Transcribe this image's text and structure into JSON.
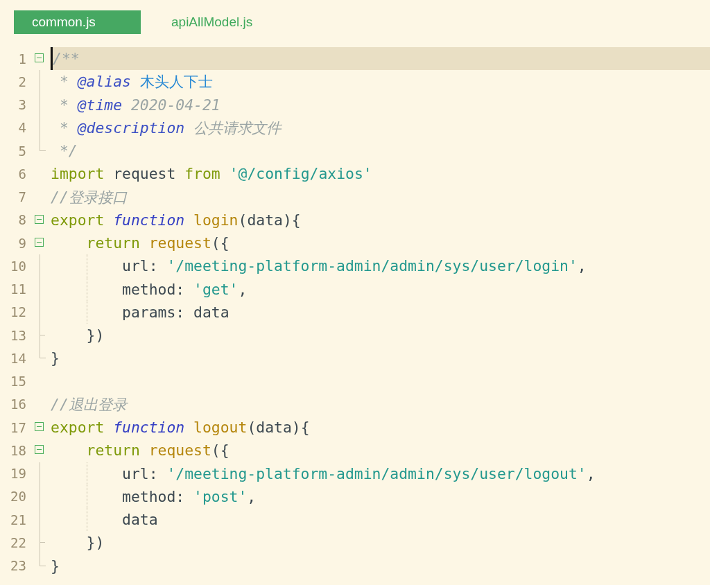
{
  "tabs": [
    {
      "label": "common.js",
      "selected": true
    },
    {
      "label": "apiAllModel.js",
      "selected": false
    }
  ],
  "lines": [
    {
      "number": "1",
      "kind": "start",
      "expanded": true,
      "current": true,
      "tokens": [
        {
          "text": "/**",
          "kind": "comment"
        }
      ]
    },
    {
      "number": "2",
      "kind": "body",
      "current": false,
      "tokens": [
        {
          "text": " * ",
          "kind": "comment"
        },
        {
          "text": "@alias ",
          "kind": "doc-tag"
        },
        {
          "text": "木头人下士",
          "kind": "doc-name"
        }
      ]
    },
    {
      "number": "3",
      "kind": "body",
      "current": false,
      "tokens": [
        {
          "text": " * ",
          "kind": "comment"
        },
        {
          "text": "@time",
          "kind": "doc-tag"
        },
        {
          "text": " 2020-04-21",
          "kind": "comment"
        }
      ]
    },
    {
      "number": "4",
      "kind": "body",
      "current": false,
      "tokens": [
        {
          "text": " * ",
          "kind": "comment"
        },
        {
          "text": "@description",
          "kind": "doc-tag"
        },
        {
          "text": " 公共请求文件",
          "kind": "comment"
        }
      ]
    },
    {
      "number": "5",
      "kind": "end",
      "current": false,
      "tokens": [
        {
          "text": " */",
          "kind": "comment"
        }
      ]
    },
    {
      "number": "6",
      "kind": "plain",
      "current": false,
      "tokens": [
        {
          "text": "import",
          "kind": "keyword"
        },
        {
          "text": " request ",
          "kind": "plain"
        },
        {
          "text": "from ",
          "kind": "keyword"
        },
        {
          "text": "'@/config/axios'",
          "kind": "string"
        }
      ]
    },
    {
      "number": "7",
      "kind": "plain",
      "current": false,
      "tokens": [
        {
          "text": "//登录接口",
          "kind": "comment"
        }
      ]
    },
    {
      "number": "8",
      "kind": "start",
      "expanded": true,
      "current": false,
      "tokens": [
        {
          "text": "export ",
          "kind": "keyword"
        },
        {
          "text": "function ",
          "kind": "storage"
        },
        {
          "text": "login",
          "kind": "entity"
        },
        {
          "text": "(data){",
          "kind": "plain"
        }
      ]
    },
    {
      "number": "9",
      "kind": "start",
      "expanded": true,
      "current": false,
      "tokens": [
        {
          "text": "    return ",
          "kind": "keyword"
        },
        {
          "text": "request",
          "kind": "entity"
        },
        {
          "text": "({",
          "kind": "plain"
        }
      ]
    },
    {
      "number": "10",
      "kind": "body",
      "current": false,
      "tokens": [
        {
          "text": "        url: ",
          "kind": "plain"
        },
        {
          "text": "'/meeting-platform-admin/admin/sys/user/login'",
          "kind": "string"
        },
        {
          "text": ",",
          "kind": "plain"
        }
      ]
    },
    {
      "number": "11",
      "kind": "body",
      "current": false,
      "tokens": [
        {
          "text": "        method: ",
          "kind": "plain"
        },
        {
          "text": "'get'",
          "kind": "string"
        },
        {
          "text": ",",
          "kind": "plain"
        }
      ]
    },
    {
      "number": "12",
      "kind": "body",
      "current": false,
      "tokens": [
        {
          "text": "        params: data",
          "kind": "plain"
        }
      ]
    },
    {
      "number": "13",
      "kind": "branch",
      "current": false,
      "tokens": [
        {
          "text": "    })",
          "kind": "plain"
        }
      ]
    },
    {
      "number": "14",
      "kind": "end",
      "current": false,
      "tokens": [
        {
          "text": "}",
          "kind": "plain"
        }
      ]
    },
    {
      "number": "15",
      "kind": "plain",
      "current": false
    },
    {
      "number": "16",
      "kind": "plain",
      "current": false,
      "tokens": [
        {
          "text": "//退出登录",
          "kind": "comment"
        }
      ]
    },
    {
      "number": "17",
      "kind": "start",
      "expanded": true,
      "current": false,
      "tokens": [
        {
          "text": "export ",
          "kind": "keyword"
        },
        {
          "text": "function ",
          "kind": "storage"
        },
        {
          "text": "logout",
          "kind": "entity"
        },
        {
          "text": "(data){",
          "kind": "plain"
        }
      ]
    },
    {
      "number": "18",
      "kind": "start",
      "expanded": true,
      "current": false,
      "tokens": [
        {
          "text": "    return ",
          "kind": "keyword"
        },
        {
          "text": "request",
          "kind": "entity"
        },
        {
          "text": "({",
          "kind": "plain"
        }
      ]
    },
    {
      "number": "19",
      "kind": "body",
      "current": false,
      "tokens": [
        {
          "text": "        url: ",
          "kind": "plain"
        },
        {
          "text": "'/meeting-platform-admin/admin/sys/user/logout'",
          "kind": "string"
        },
        {
          "text": ",",
          "kind": "plain"
        }
      ]
    },
    {
      "number": "20",
      "kind": "body",
      "current": false,
      "tokens": [
        {
          "text": "        method: ",
          "kind": "plain"
        },
        {
          "text": "'post'",
          "kind": "string"
        },
        {
          "text": ",",
          "kind": "plain"
        }
      ]
    },
    {
      "number": "21",
      "kind": "body",
      "current": false,
      "tokens": [
        {
          "text": "        data",
          "kind": "plain"
        }
      ]
    },
    {
      "number": "22",
      "kind": "branch",
      "current": false,
      "tokens": [
        {
          "text": "    })",
          "kind": "plain"
        }
      ]
    },
    {
      "number": "23",
      "kind": "end",
      "current": false,
      "tokens": [
        {
          "text": "}",
          "kind": "plain"
        }
      ]
    }
  ]
}
